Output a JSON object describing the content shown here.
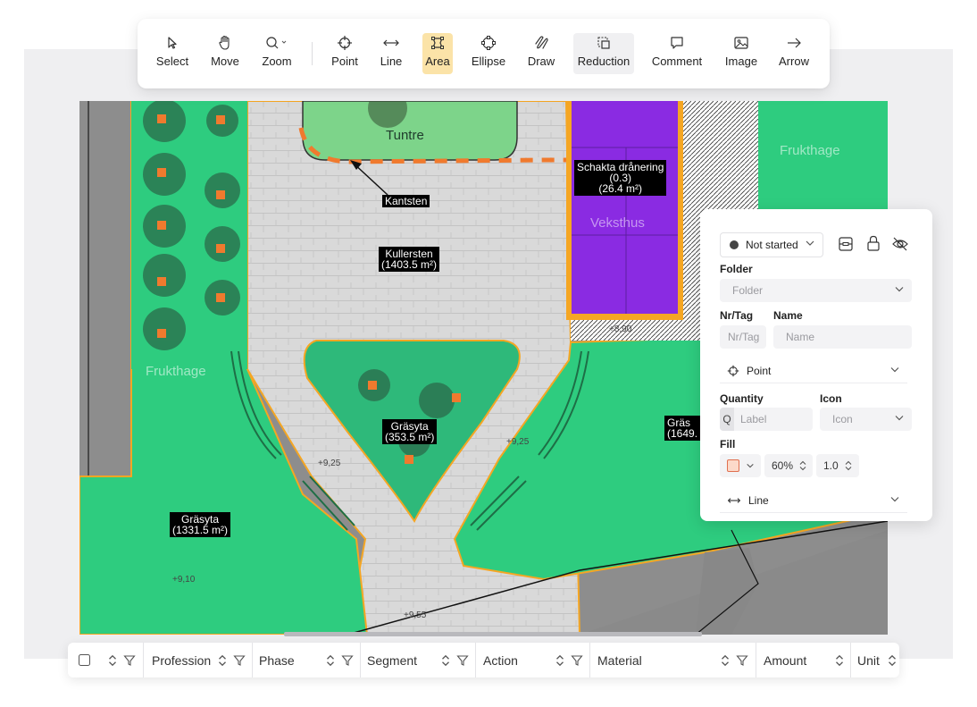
{
  "toolbar": {
    "tools": [
      {
        "label": "Select",
        "icon": "cursor-icon"
      },
      {
        "label": "Move",
        "icon": "hand-icon"
      },
      {
        "label": "Zoom",
        "icon": "magnifier-icon"
      },
      {
        "label": "Point",
        "icon": "crosshair-icon"
      },
      {
        "label": "Line",
        "icon": "double-arrow-icon"
      },
      {
        "label": "Area",
        "icon": "polygon-icon",
        "active": true
      },
      {
        "label": "Ellipse",
        "icon": "ellipse-icon"
      },
      {
        "label": "Draw",
        "icon": "freehand-icon"
      },
      {
        "label": "Reduction",
        "icon": "reduction-icon"
      },
      {
        "label": "Comment",
        "icon": "comment-icon"
      },
      {
        "label": "Image",
        "icon": "image-icon"
      },
      {
        "label": "Arrow",
        "icon": "arrow-right-icon"
      }
    ]
  },
  "canvas": {
    "labels": {
      "schakta": [
        "Schakta drånering",
        "(0.3)",
        "(26.4 m²)"
      ],
      "kantsten": "Kantsten",
      "kullersten": [
        "Kullersten",
        "(1403.5 m²)"
      ],
      "grasyta_mid": [
        "Gräsyta",
        "(353.5 m²)"
      ],
      "grasyta_left": [
        "Gräsyta",
        "(1331.5 m²)"
      ],
      "grasyta_right": [
        "Gräs",
        "(1649."
      ]
    },
    "words": {
      "tuntre": "Tuntre",
      "frukthage_top": "Frukthage",
      "frukthage_left": "Frukthage",
      "veksthus": "Veksthus"
    },
    "elevations": {
      "e890": "+8,90",
      "e925": "+9,25",
      "e925b": "+9,25",
      "e910": "+9,10",
      "e955": "+9,55"
    },
    "colors": {
      "grass": "#2ecc7f",
      "veksthus": "#8a2be2",
      "border": "#f5a623",
      "marker": "#f07a2e"
    }
  },
  "panel": {
    "status": "Not started",
    "folder_label": "Folder",
    "folder_placeholder": "Folder",
    "nrtag_label": "Nr/Tag",
    "nrtag_placeholder": "Nr/Tag",
    "name_label": "Name",
    "name_placeholder": "Name",
    "point_section": "Point",
    "quantity_label": "Quantity",
    "quantity_prefix": "Q",
    "quantity_placeholder": "Label",
    "icon_label": "Icon",
    "icon_placeholder": "Icon",
    "fill_label": "Fill",
    "fill_color": "#fcd9c9",
    "fill_opacity": "60%",
    "fill_width": "1.0",
    "line_section": "Line"
  },
  "table": {
    "columns": [
      "Profession",
      "Phase",
      "Segment",
      "Action",
      "Material",
      "Amount",
      "Unit"
    ]
  }
}
